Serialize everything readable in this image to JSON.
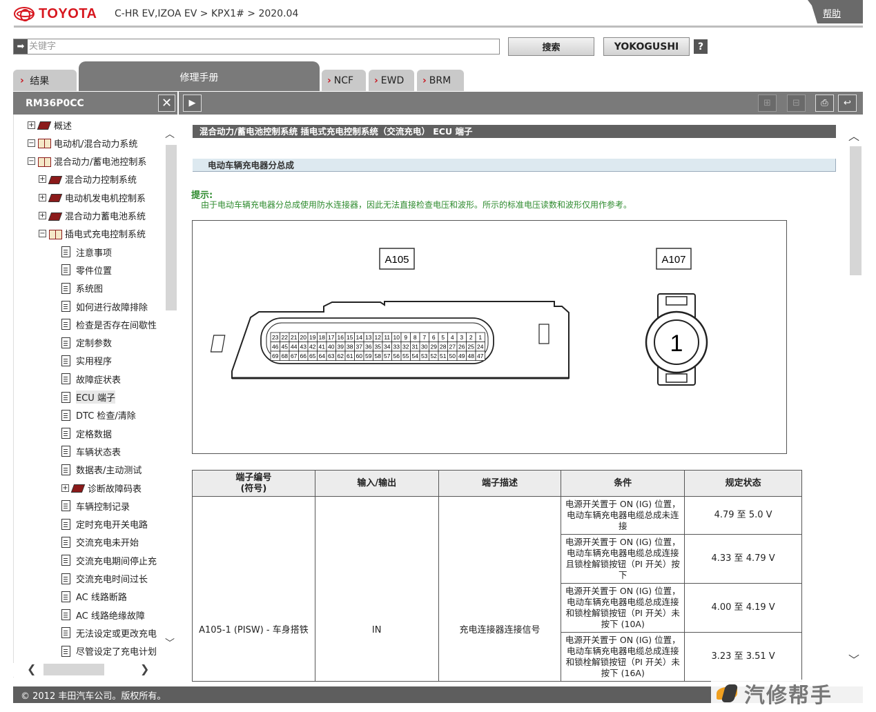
{
  "header": {
    "brand": "TOYOTA",
    "breadcrumb": "C-HR EV,IZOA EV > KPX1# > 2020.04",
    "help_label": "帮助"
  },
  "search": {
    "placeholder": "关键字",
    "value": "",
    "search_label": "搜索",
    "yokogushi_label": "YOKOGUSHI",
    "question_label": "?"
  },
  "tabs": [
    {
      "label": "结果"
    },
    {
      "label": "修理手册"
    },
    {
      "label": "NCF"
    },
    {
      "label": "EWD"
    },
    {
      "label": "BRM"
    }
  ],
  "toolbar": {
    "doc_id": "RM36P0CC",
    "close_label": "✕",
    "expand_label": "▶",
    "plus_label": "⊞",
    "minus_label": "⊟",
    "print_label": "⎙",
    "return_label": "↩"
  },
  "tree": [
    {
      "label": "概述",
      "type": "book-closed",
      "pm": "+"
    },
    {
      "label": "电动机/混合动力系统",
      "type": "book-open",
      "pm": "−"
    },
    {
      "label": "混合动力/蓄电池控制系",
      "type": "book-open",
      "pm": "−"
    },
    {
      "label": "混合动力控制系统",
      "type": "book-closed",
      "pm": "+"
    },
    {
      "label": "电动机发电机控制系",
      "type": "book-closed",
      "pm": "+"
    },
    {
      "label": "混合动力蓄电池系统",
      "type": "book-closed",
      "pm": "+"
    },
    {
      "label": "插电式充电控制系统",
      "type": "book-open",
      "pm": "−"
    },
    {
      "label": "注意事项",
      "type": "doc"
    },
    {
      "label": "零件位置",
      "type": "doc"
    },
    {
      "label": "系统图",
      "type": "doc"
    },
    {
      "label": "如何进行故障排除",
      "type": "doc"
    },
    {
      "label": "检查是否存在间歇性",
      "type": "doc"
    },
    {
      "label": "定制参数",
      "type": "doc"
    },
    {
      "label": "实用程序",
      "type": "doc"
    },
    {
      "label": "故障症状表",
      "type": "doc"
    },
    {
      "label": "ECU 端子",
      "type": "doc",
      "selected": true
    },
    {
      "label": "DTC 检查/清除",
      "type": "doc"
    },
    {
      "label": "定格数据",
      "type": "doc"
    },
    {
      "label": "车辆状态表",
      "type": "doc"
    },
    {
      "label": "数据表/主动测试",
      "type": "doc"
    },
    {
      "label": "诊断故障码表",
      "type": "book-closed",
      "pm": "+"
    },
    {
      "label": "车辆控制记录",
      "type": "doc"
    },
    {
      "label": "定时充电开关电路",
      "type": "doc"
    },
    {
      "label": "交流充电未开始",
      "type": "doc"
    },
    {
      "label": "交流充电期间停止充",
      "type": "doc"
    },
    {
      "label": "交流充电时间过长",
      "type": "doc"
    },
    {
      "label": "AC 线路断路",
      "type": "doc"
    },
    {
      "label": "AC 线路绝缘故障",
      "type": "doc"
    },
    {
      "label": "无法设定或更改充电",
      "type": "doc"
    },
    {
      "label": "尽管设定了充电计划",
      "type": "doc"
    }
  ],
  "content": {
    "section_title": "混合动力/蓄电池控制系统  插电式充电控制系统（交流充电）   ECU 端子",
    "subsection_title": "电动车辆充电器分总成",
    "hint_title": "提示:",
    "hint_text": "由于电动车辆充电器分总成使用防水连接器，因此无法直接检查电压和波形。所示的标准电压读数和波形仅用作参考。",
    "figure": {
      "connector_a_label": "A105",
      "connector_b_label": "A107",
      "connector_b_pin": "1",
      "row1": [
        "23",
        "22",
        "21",
        "20",
        "19",
        "18",
        "17",
        "16",
        "15",
        "14",
        "13",
        "12",
        "11",
        "10",
        "9",
        "8",
        "7",
        "6",
        "5",
        "4",
        "3",
        "2",
        "1"
      ],
      "row2": [
        "46",
        "45",
        "44",
        "43",
        "42",
        "41",
        "40",
        "39",
        "38",
        "37",
        "36",
        "35",
        "34",
        "33",
        "32",
        "31",
        "30",
        "29",
        "28",
        "27",
        "26",
        "25",
        "24"
      ],
      "row3": [
        "69",
        "68",
        "67",
        "66",
        "65",
        "64",
        "63",
        "62",
        "61",
        "60",
        "59",
        "58",
        "57",
        "56",
        "55",
        "54",
        "53",
        "52",
        "51",
        "50",
        "49",
        "48",
        "47"
      ]
    },
    "table": {
      "headers": [
        "端子编号\n(符号)",
        "输入/输出",
        "端子描述",
        "条件",
        "规定状态"
      ],
      "terminal": "A105-1 (PISW) - 车身搭铁",
      "io": "IN",
      "description": "充电连接器连接信号",
      "rows": [
        {
          "condition": "电源开关置于 ON (IG) 位置，电动车辆充电器电缆总成未连接",
          "spec": "4.79 至 5.0 V"
        },
        {
          "condition": "电源开关置于 ON (IG) 位置，电动车辆充电器电缆总成连接且锁栓解锁按钮（PI 开关）按下",
          "spec": "4.33 至 4.79 V"
        },
        {
          "condition": "电源开关置于 ON (IG) 位置，电动车辆充电器电缆总成连接和锁栓解锁按钮（PI 开关）未按下 (10A)",
          "spec": "4.00 至 4.19 V"
        },
        {
          "condition": "电源开关置于 ON (IG) 位置，电动车辆充电器电缆总成连接和锁栓解锁按钮（PI 开关）未按下 (16A)",
          "spec": "3.23 至 3.51 V"
        }
      ]
    }
  },
  "footer": {
    "copyright": "© 2012 丰田汽车公司。版权所有。",
    "watermark": "汽修帮手"
  },
  "colors": {
    "brand_red": "#d7171f",
    "hint_green": "#2e8b2e",
    "toolbar_gray": "#7a7a7a"
  }
}
